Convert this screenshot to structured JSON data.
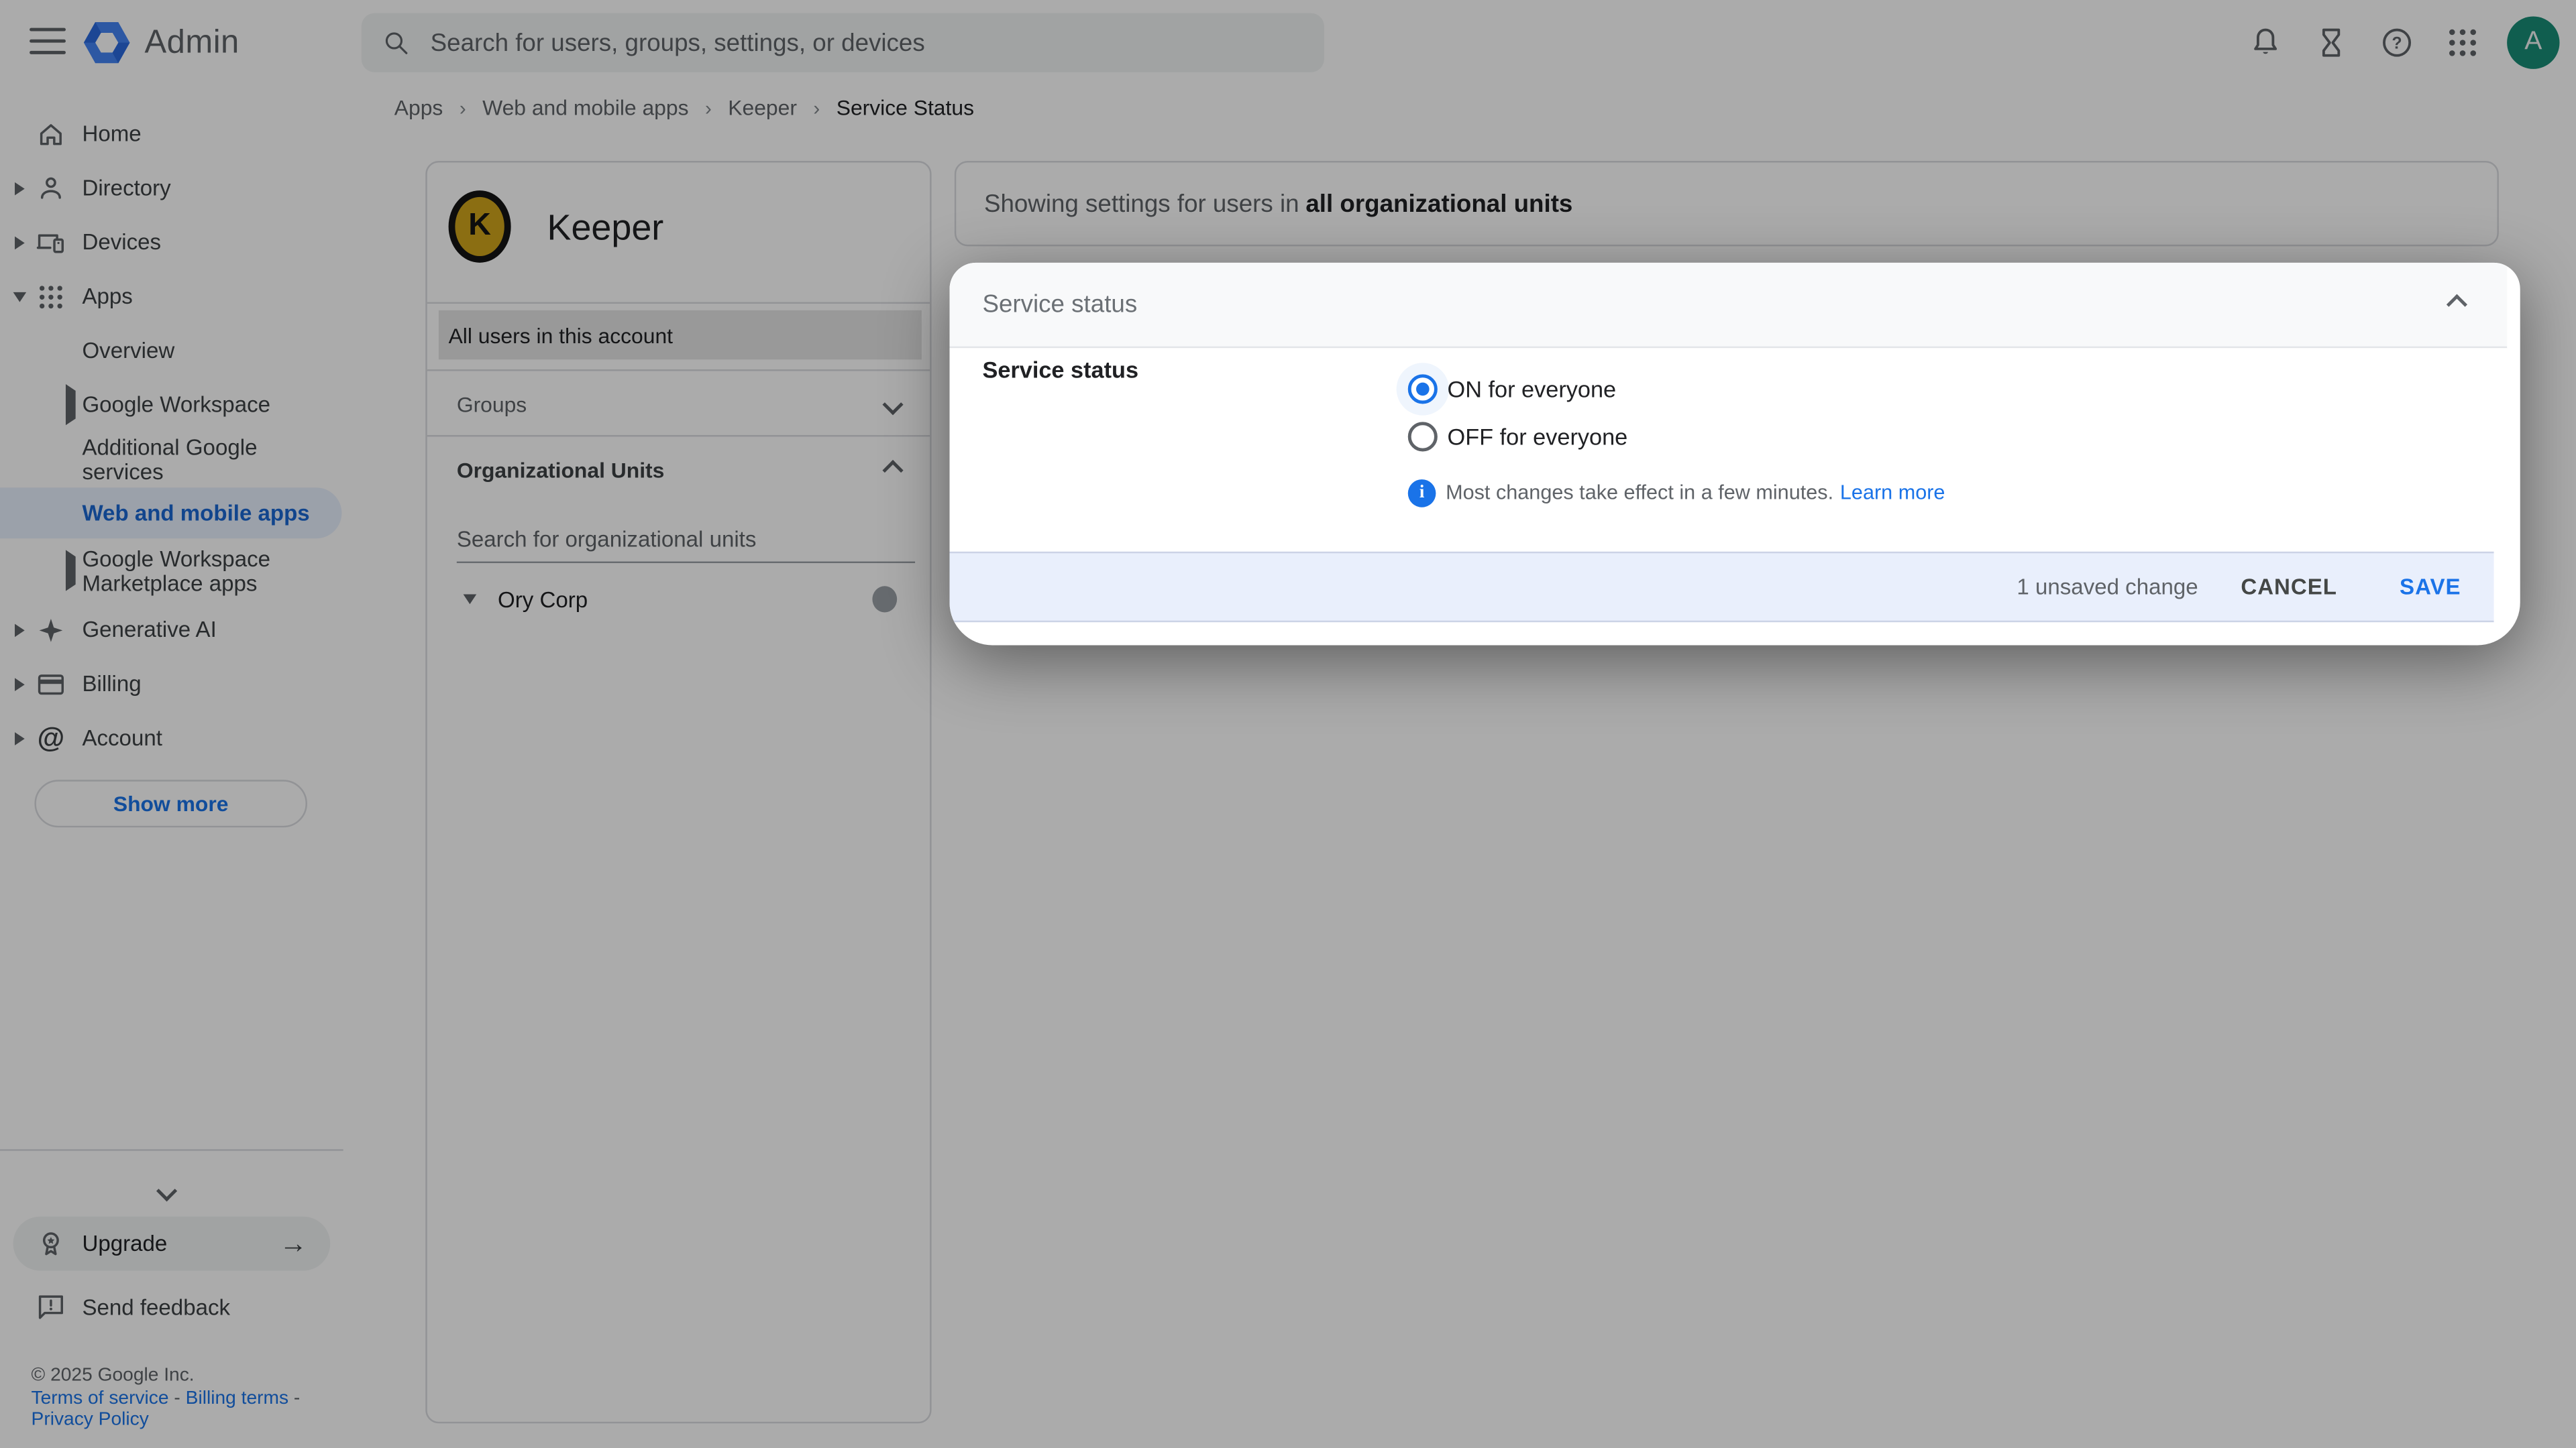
{
  "header": {
    "product": "Admin",
    "search_placeholder": "Search for users, groups, settings, or devices",
    "avatar_letter": "A"
  },
  "breadcrumb": {
    "separator": "›",
    "items": [
      "Apps",
      "Web and mobile apps",
      "Keeper",
      "Service Status"
    ]
  },
  "sidebar": {
    "items": [
      {
        "label": "Home"
      },
      {
        "label": "Directory"
      },
      {
        "label": "Devices"
      },
      {
        "label": "Apps"
      },
      {
        "label": "Overview"
      },
      {
        "label": "Google Workspace"
      },
      {
        "label": "Additional Google services"
      },
      {
        "label": "Web and mobile apps"
      },
      {
        "label": "Google Workspace Marketplace apps"
      },
      {
        "label": "Generative AI"
      },
      {
        "label": "Billing"
      },
      {
        "label": "Account"
      }
    ],
    "show_more_label": "Show more",
    "upgrade_label": "Upgrade",
    "send_feedback_label": "Send feedback",
    "copyright": "© 2025 Google Inc.",
    "links": {
      "terms": "Terms of service",
      "billing": "Billing terms",
      "privacy": "Privacy Policy",
      "dash1": "-",
      "dash2": "-"
    }
  },
  "panel": {
    "app_name": "Keeper",
    "all_users_label": "All users in this account",
    "groups_label": "Groups",
    "org_units_label": "Organizational Units",
    "search_placeholder": "Search for organizational units",
    "org_root": "Ory Corp"
  },
  "main": {
    "scope_prefix": "Showing settings for users in",
    "scope_bold": "all organizational units"
  },
  "dialog": {
    "title": "Service status",
    "label": "Service status",
    "radio_on": "ON for everyone",
    "radio_off": "OFF for everyone",
    "info_text": "Most changes take effect in a few minutes.",
    "learn_more": "Learn more",
    "unsaved": "1 unsaved change",
    "cancel": "CANCEL",
    "save": "SAVE"
  },
  "icons": {
    "at_symbol": "@",
    "arrow_right": "→",
    "keeper_monogram": "K"
  },
  "colors": {
    "accent": "#1a73e8",
    "avatar_bg": "#188c77",
    "keeper_yellow": "#d0a41c",
    "footer_bar_bg": "#e9effc",
    "selected_pill_bg": "#e8f0fe"
  }
}
